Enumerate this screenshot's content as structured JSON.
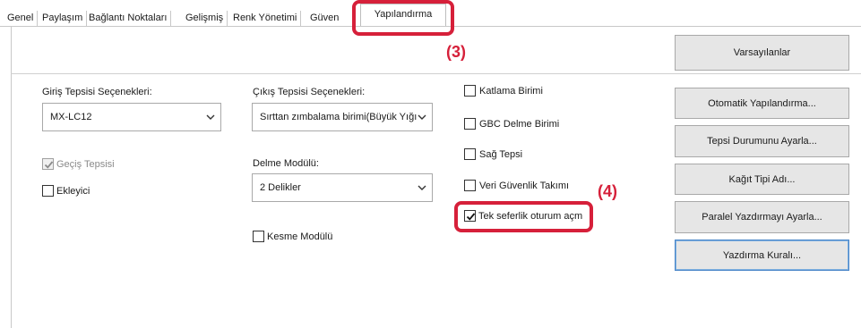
{
  "tabs": [
    {
      "label": "Genel"
    },
    {
      "label": "Paylaşım"
    },
    {
      "label": "Bağlantı Noktaları"
    },
    {
      "label": "Gelişmiş"
    },
    {
      "label": "Renk Yönetimi"
    },
    {
      "label": "Güven"
    },
    {
      "label": "Yapılandırma",
      "active": true
    }
  ],
  "callouts": {
    "step3": "(3)",
    "step4": "(4)",
    "color": "#d6203a"
  },
  "buttons": {
    "defaults": "Varsayılanlar",
    "auto_config": "Otomatik Yapılandırma...",
    "tray_status": "Tepsi Durumunu Ayarla...",
    "paper_type": "Kağıt Tipi Adı...",
    "parallel_print": "Paralel Yazdırmayı Ayarla...",
    "print_policy": "Yazdırma Kuralı..."
  },
  "input_tray": {
    "label": "Giriş Tepsisi Seçenekleri:",
    "value": "MX-LC12"
  },
  "output_tray": {
    "label": "Çıkış Tepsisi Seçenekleri:",
    "value": "Sırttan zımbalama birimi(Büyük Yığı"
  },
  "punch_module": {
    "label": "Delme Modülü:",
    "value": "2 Delikler"
  },
  "checkboxes": {
    "bypass_tray": {
      "label": "Geçiş Tepsisi",
      "checked": true,
      "disabled": true
    },
    "inserter": {
      "label": "Ekleyici",
      "checked": false
    },
    "trimming_module": {
      "label": "Kesme Modülü",
      "checked": false
    },
    "folding_unit": {
      "label": "Katlama Birimi",
      "checked": false
    },
    "gbc_punch": {
      "label": "GBC Delme Birimi",
      "checked": false
    },
    "right_tray": {
      "label": "Sağ Tepsi",
      "checked": false
    },
    "data_security_kit": {
      "label": "Veri Güvenlik Takımı",
      "checked": false
    },
    "single_signon": {
      "label": "Tek seferlik oturum açm",
      "checked": true
    }
  },
  "icons": {
    "check": "check-icon",
    "dropdown": "chevron-down-icon"
  }
}
